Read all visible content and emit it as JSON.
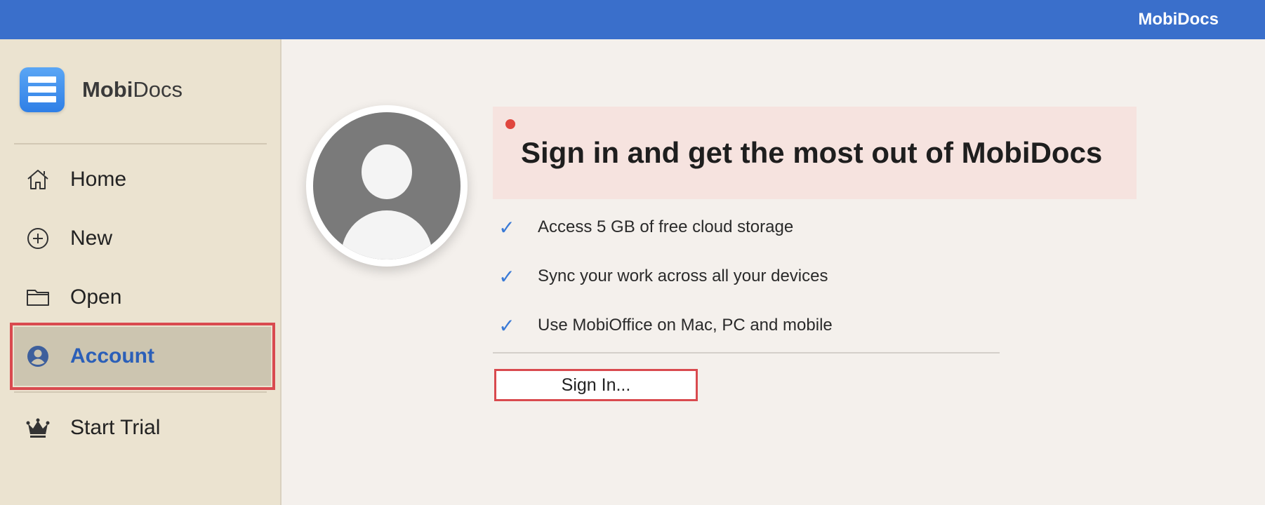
{
  "window": {
    "title": "MobiDocs"
  },
  "sidebar": {
    "brand": {
      "bold": "Mobi",
      "regular": "Docs",
      "icon": "document-lines-icon"
    },
    "items": [
      {
        "label": "Home",
        "icon": "home-icon"
      },
      {
        "label": "New",
        "icon": "plus-circle-icon"
      },
      {
        "label": "Open",
        "icon": "folder-icon"
      },
      {
        "label": "Account",
        "icon": "user-circle-icon",
        "active": true
      },
      {
        "label": "Start Trial",
        "icon": "crown-icon"
      }
    ]
  },
  "main": {
    "avatar_icon": "user-avatar-icon",
    "banner_title": "Sign in and get the most out of MobiDocs",
    "features": [
      "Access 5 GB of free cloud storage",
      "Sync your work across all your devices",
      "Use MobiOffice on Mac, PC and mobile"
    ],
    "check_glyph": "✓",
    "sign_in_label": "Sign In..."
  },
  "colors": {
    "topbar": "#3a6fcb",
    "sidebar": "#ebe3d0",
    "active_item": "#ccc5b0",
    "highlight_border": "#d94a4f",
    "active_text": "#2b5fb8",
    "banner": "#f6e3df",
    "check": "#3a7ad6"
  }
}
